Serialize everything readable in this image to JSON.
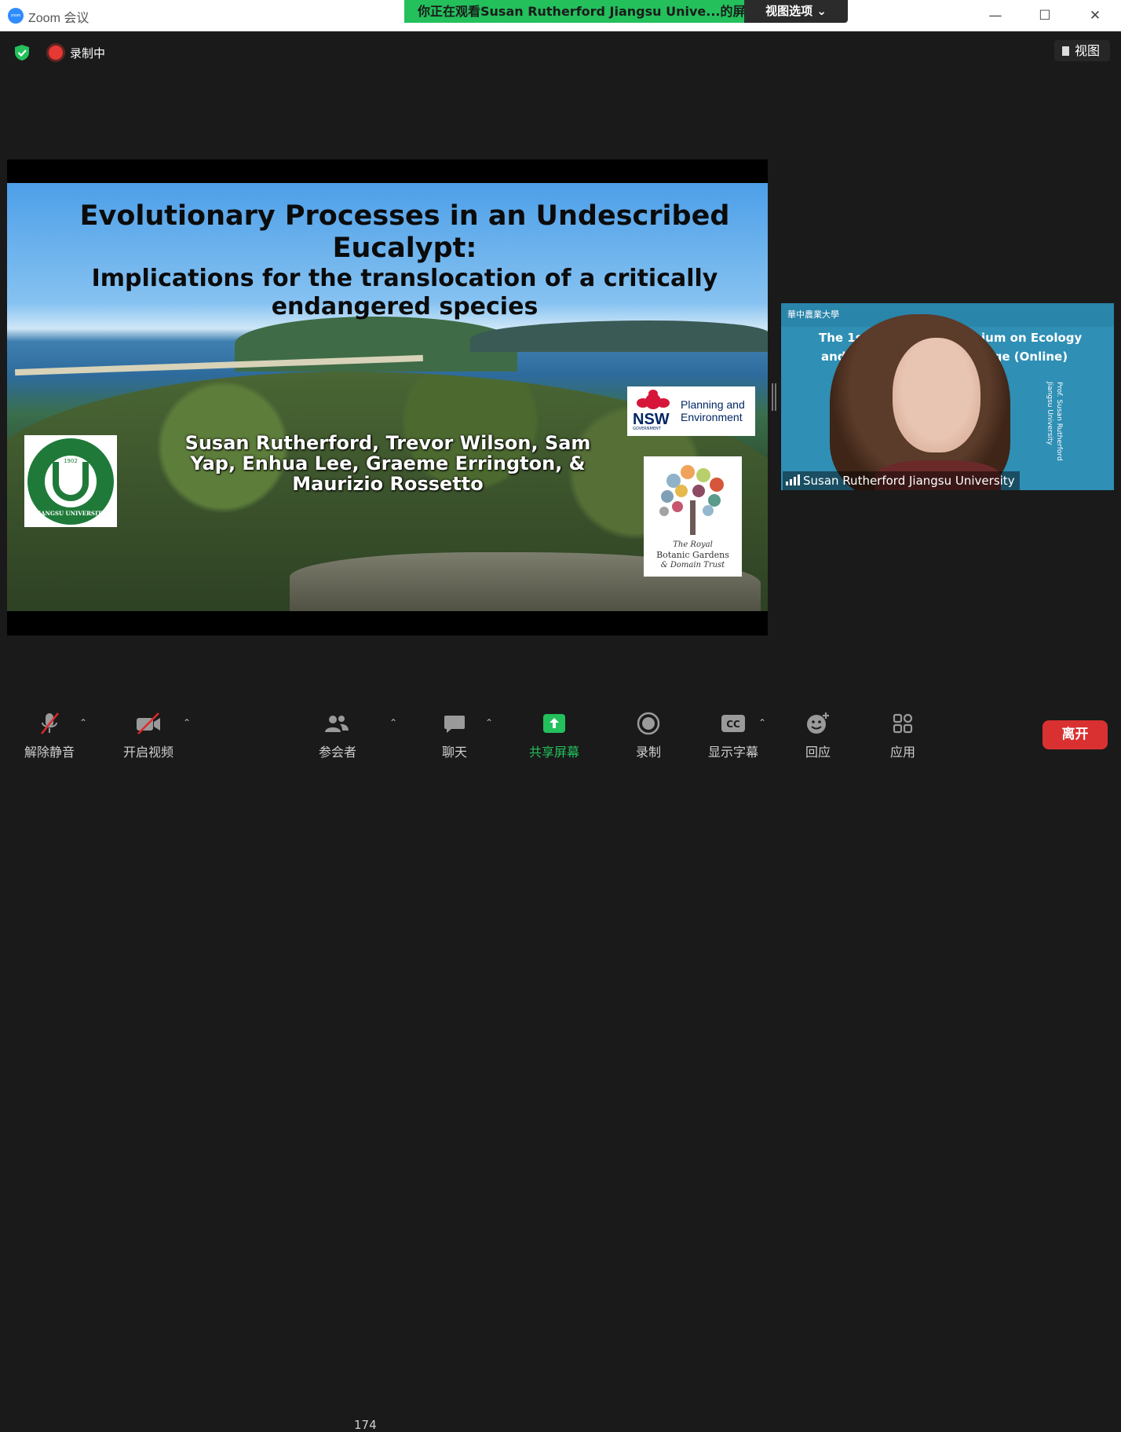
{
  "titlebar": {
    "logo_text": "zoom",
    "app_title": "Zoom 会议",
    "share_banner": "你正在观看Susan Rutherford Jiangsu Unive...的屏幕",
    "view_options": "视图选项 ⌄",
    "minimize_icon": "minimize-icon",
    "maximize_icon": "maximize-icon",
    "close_icon": "close-icon"
  },
  "topbar": {
    "recording_label": "录制中",
    "view_label": "视图"
  },
  "slide": {
    "title": "Evolutionary Processes in an Undescribed Eucalypt:",
    "subtitle": "Implications for the translocation of a critically endangered species",
    "authors": "Susan Rutherford, Trevor Wilson, Sam Yap, Enhua Lee, Graeme Errington, & Maurizio Rossetto",
    "ju_logo": {
      "year": "1902",
      "text": "JIANGSU UNIVERSITY"
    },
    "nsw_logo": {
      "acronym": "NSW",
      "gov": "GOVERNMENT",
      "line1": "Planning and",
      "line2": "Environment"
    },
    "rbg_logo": {
      "line1": "The Royal",
      "line2": "Botanic Gardens",
      "line3": "& Domain Trust"
    }
  },
  "video_tile": {
    "banner_logo": "華中農業大學",
    "line1a": "The 1st Inter",
    "line1b": "ium on Ecology",
    "line2a": "and Evolu",
    "line2b": "nge (Online)",
    "vertical_text": "Prof. Susan Rutherford Jiangsu University",
    "name": "Susan Rutherford Jiangsu University"
  },
  "toolbar": {
    "unmute": "解除静音",
    "start_video": "开启视频",
    "participants": "参会者",
    "participant_count": "174",
    "chat": "聊天",
    "share_screen": "共享屏幕",
    "record": "录制",
    "captions": "显示字幕",
    "captions_icon_text": "CC",
    "reactions": "回应",
    "apps": "应用",
    "leave": "离开"
  },
  "colors": {
    "accent_green": "#23c05c",
    "leave_red": "#d93131",
    "zoom_blue": "#2d8cff"
  }
}
